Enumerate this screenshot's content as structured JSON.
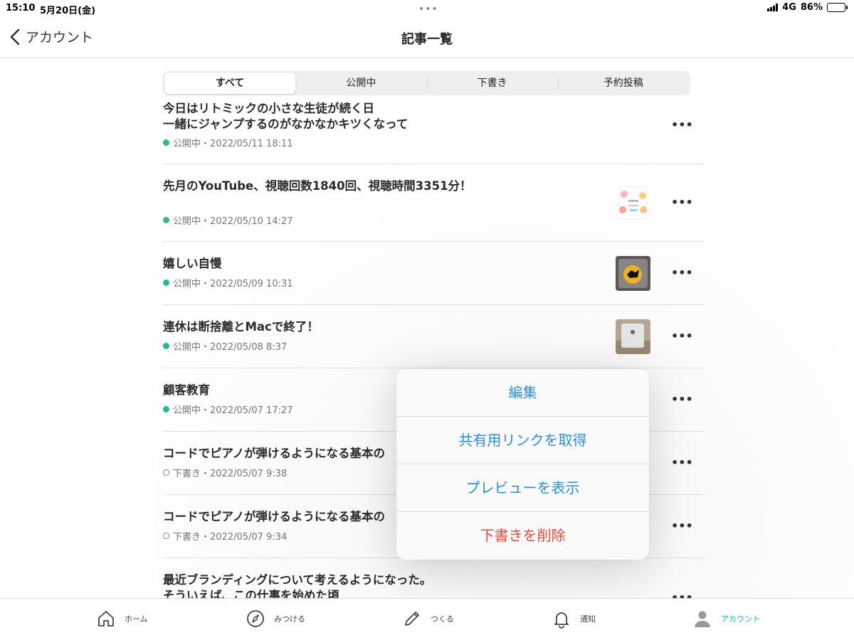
{
  "status": {
    "time": "15:10",
    "date": "5月20日(金)",
    "network": "4G",
    "battery": "86%",
    "battery_level": 0.86
  },
  "nav": {
    "back_label": "アカウント",
    "title": "記事一覧"
  },
  "tabs": [
    {
      "label": "すべて"
    },
    {
      "label": "公開中"
    },
    {
      "label": "下書き"
    },
    {
      "label": "予約投稿"
    }
  ],
  "articles": [
    {
      "title_line1": "今日はリトミックの小さな生徒が続く日",
      "title_line2": "一緒にジャンプするのがなかなかキツくなって",
      "meta": "公開中・2022/05/11 18:11",
      "status": "published"
    },
    {
      "title_line1": "先月のYouTube、視聴回数1840回、視聴時間3351分！",
      "meta": "公開中・2022/05/10 14:27",
      "status": "published"
    },
    {
      "title_line1": "嬉しい自慢",
      "meta": "公開中・2022/05/09 10:31",
      "status": "published"
    },
    {
      "title_line1": "連休は断捨離とMacで終了！",
      "meta": "公開中・2022/05/08 8:37",
      "status": "published"
    },
    {
      "title_line1": "顧客教育",
      "meta": "公開中・2022/05/07 17:27",
      "status": "published"
    },
    {
      "title_line1": "コードでピアノが弾けるようになる基本の",
      "meta": "下書き・2022/05/07 9:38",
      "status": "draft"
    },
    {
      "title_line1": "コードでピアノが弾けるようになる基本の",
      "meta": "下書き・2022/05/07 9:34",
      "status": "draft"
    },
    {
      "title_line1": "最近ブランディングについて考えるようになった。",
      "title_line2": "そういえば、この仕事を始めた頃",
      "status": "published"
    }
  ],
  "menu": {
    "edit": "編集",
    "share": "共有用リンクを取得",
    "preview": "プレビューを表示",
    "delete": "下書きを削除"
  },
  "tabbar": {
    "home": "ホーム",
    "discover": "みつける",
    "create": "つくる",
    "notify": "通知",
    "account": "アカウント"
  },
  "colors": {
    "accent": "#2cb696",
    "link": "#2f8fd6",
    "danger": "#e8473b"
  }
}
